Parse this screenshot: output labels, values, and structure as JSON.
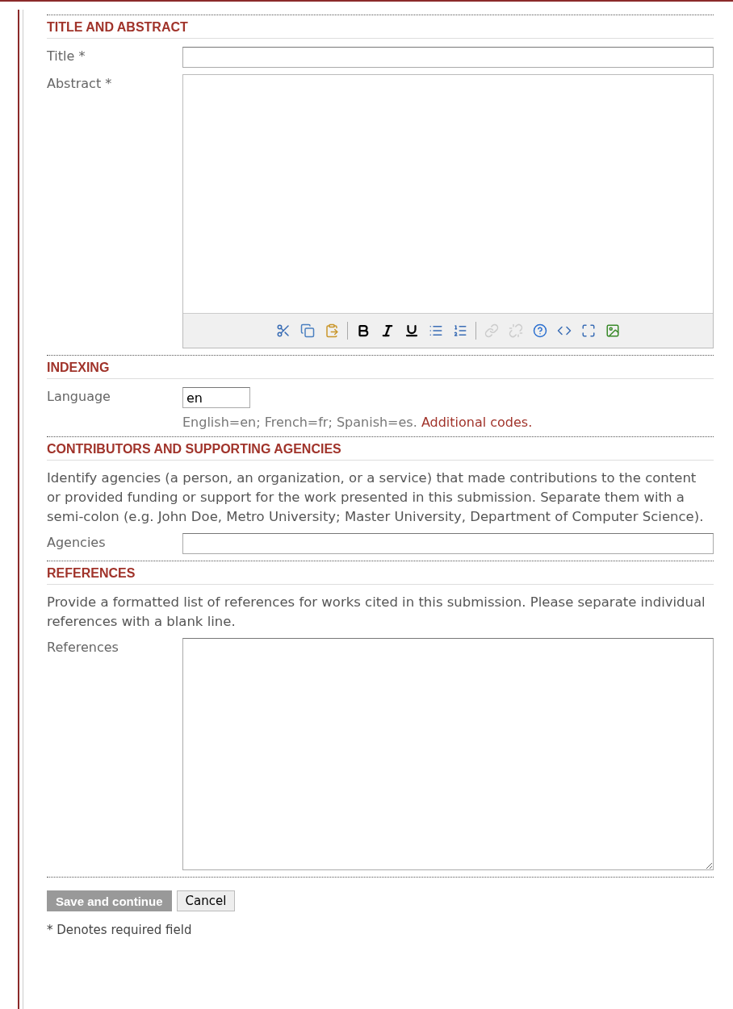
{
  "sections": [
    {
      "heading": "TITLE AND ABSTRACT",
      "fields": [
        {
          "kind": "text",
          "label": "Title *"
        },
        {
          "kind": "editor",
          "label": "Abstract *",
          "toolbar": [
            [
              {
                "disabled": false
              },
              {
                "disabled": false
              },
              {
                "disabled": false
              }
            ],
            [
              {
                "disabled": false
              },
              {
                "disabled": false
              },
              {
                "disabled": false
              },
              {
                "disabled": false
              },
              {
                "disabled": false
              }
            ],
            [
              {
                "disabled": true
              },
              {
                "disabled": true
              },
              {
                "disabled": false
              },
              {
                "disabled": false
              },
              {
                "disabled": false
              },
              {
                "disabled": false
              }
            ]
          ]
        }
      ]
    },
    {
      "heading": "INDEXING",
      "fields": [
        {
          "kind": "short",
          "label": "Language",
          "value": "en",
          "help": "English=en; French=fr; Spanish=es.",
          "help_link": "Additional codes."
        }
      ]
    },
    {
      "heading": "CONTRIBUTORS AND SUPPORTING AGENCIES",
      "intro": "Identify agencies (a person, an organization, or a service) that made contributions to the content or provided funding or support for the work presented in this submission. Separate them with a semi-colon (e.g. John Doe, Metro University; Master University, Department of Computer Science).",
      "fields": [
        {
          "kind": "text",
          "label": "Agencies"
        }
      ]
    },
    {
      "heading": "REFERENCES",
      "intro": "Provide a formatted list of references for works cited in this submission. Please separate individual references with a blank line.",
      "fields": [
        {
          "kind": "textarea",
          "label": "References"
        }
      ]
    }
  ],
  "buttons": [
    {
      "label": "Save and continue",
      "disabled": true
    },
    {
      "label": "Cancel",
      "disabled": false
    }
  ],
  "footnote": "* Denotes required field"
}
